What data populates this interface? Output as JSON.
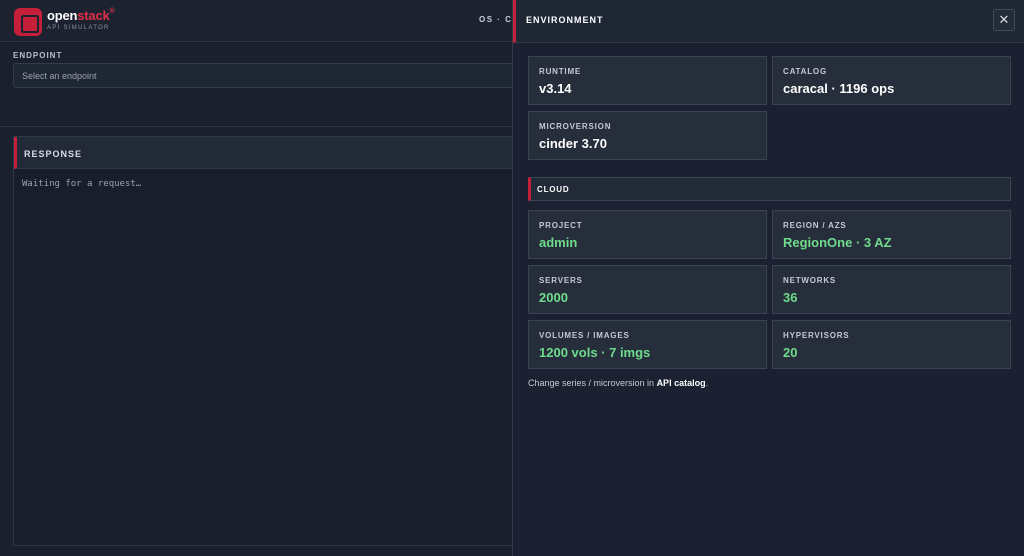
{
  "app": {
    "logo_prefix": "open",
    "logo_accent": "stack",
    "logo_reg": "®",
    "logo_sub": "API SIMULATOR",
    "center_tabs": "OS · CA"
  },
  "endpoint": {
    "label": "ENDPOINT",
    "placeholder": "Select an endpoint"
  },
  "response": {
    "title": "RESPONSE",
    "body": "Waiting for a request…"
  },
  "drawer": {
    "title": "ENVIRONMENT",
    "close_glyph": "✕",
    "cards": {
      "runtime": {
        "label": "RUNTIME",
        "value": "v3.14"
      },
      "catalog": {
        "label": "CATALOG",
        "value": "caracal · 1196 ops"
      },
      "microversion": {
        "label": "MICROVERSION",
        "value": "cinder 3.70"
      }
    },
    "cloud_section": "CLOUD",
    "cloud": {
      "project": {
        "label": "PROJECT",
        "value": "admin"
      },
      "region": {
        "label": "REGION / AZS",
        "value": "RegionOne · 3 AZ"
      },
      "servers": {
        "label": "SERVERS",
        "value": "2000"
      },
      "networks": {
        "label": "NETWORKS",
        "value": "36"
      },
      "volumes": {
        "label": "VOLUMES / IMAGES",
        "value": "1200 vols · 7 imgs"
      },
      "hypervisors": {
        "label": "HYPERVISORS",
        "value": "20"
      }
    },
    "footnote_prefix": "Change series / microversion in ",
    "footnote_link": "API catalog",
    "footnote_suffix": "."
  },
  "colors": {
    "accent": "#c5203a",
    "value_green": "#6fdc8c",
    "background": "#1a202d"
  }
}
